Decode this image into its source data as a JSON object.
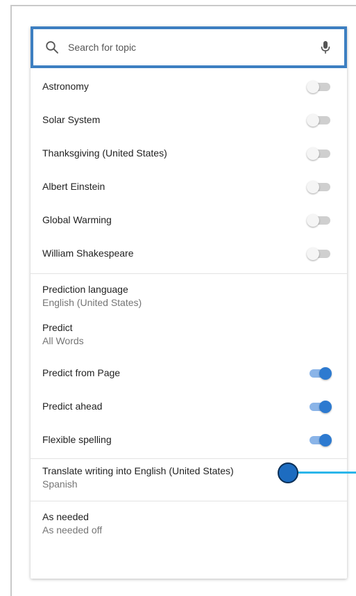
{
  "search": {
    "placeholder": "Search for topic",
    "icon": "search-icon",
    "mic_icon": "mic-icon"
  },
  "topics": [
    {
      "label": "Astronomy",
      "enabled": false
    },
    {
      "label": "Solar System",
      "enabled": false
    },
    {
      "label": "Thanksgiving (United States)",
      "enabled": false
    },
    {
      "label": "Albert Einstein",
      "enabled": false
    },
    {
      "label": "Global Warming",
      "enabled": false
    },
    {
      "label": "William Shakespeare",
      "enabled": false
    }
  ],
  "settings": {
    "prediction_language": {
      "label": "Prediction language",
      "value": "English (United States)"
    },
    "predict": {
      "label": "Predict",
      "value": "All Words"
    },
    "toggles": [
      {
        "label": "Predict from Page",
        "enabled": true
      },
      {
        "label": "Predict ahead",
        "enabled": true
      },
      {
        "label": "Flexible spelling",
        "enabled": true
      }
    ],
    "translate": {
      "label": "Translate writing into English (United States)",
      "value": "Spanish"
    },
    "as_needed": {
      "label": "As needed",
      "value": "As needed off"
    }
  },
  "colors": {
    "accent": "#2d7ad0",
    "search_border": "#3d7fc1",
    "focus_line": "#2bb6ea"
  }
}
